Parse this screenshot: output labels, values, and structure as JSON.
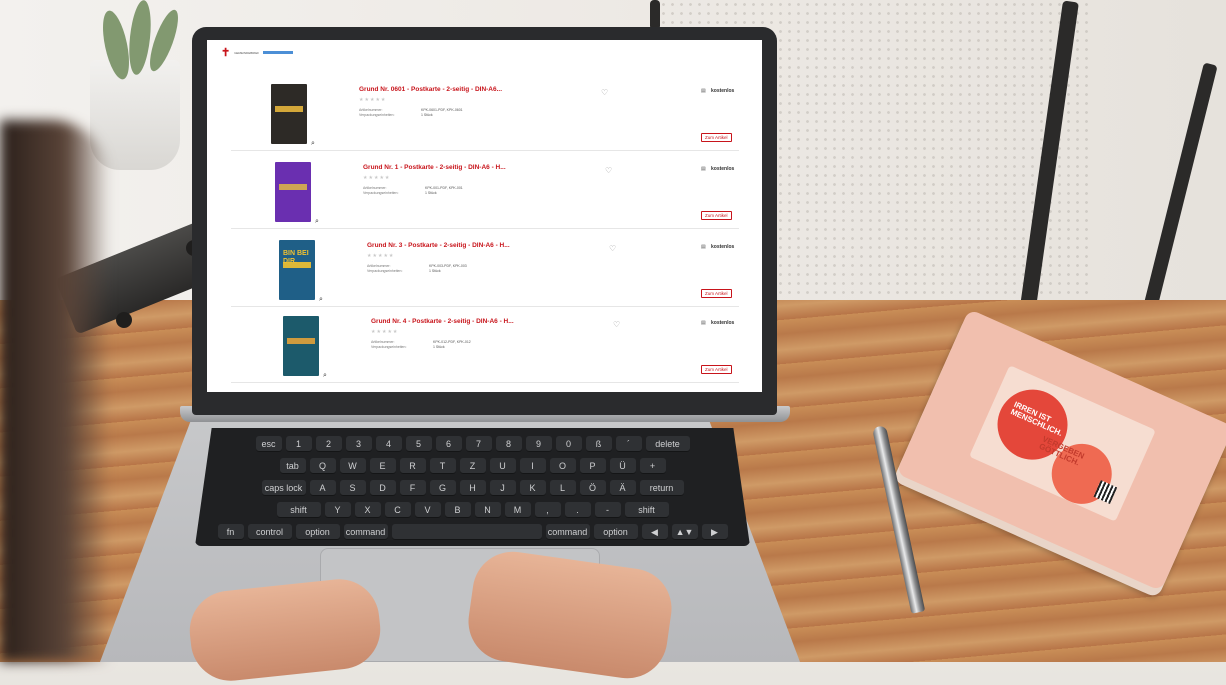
{
  "site": {
    "logo_cross": "✝",
    "logo_text": "GEMEINDEBRIEF"
  },
  "products": [
    {
      "title": "Grund Nr. 0601 - Postkarte - 2-seitig - DIN-A6...",
      "stars": "★★★★★",
      "meta_labels": "Artikelnummer:\nVerpackungseinheiten:",
      "meta_values": "KPK-0601-PDF, KPK-0601\n1 Stück",
      "price_label": "kostenlos",
      "cta": "Zum Artikel",
      "thumb_color": "#2d2a26",
      "accent": "#e6b53c"
    },
    {
      "title": "Grund Nr. 1 - Postkarte - 2-seitig - DIN-A6 - H...",
      "stars": "★★★★★",
      "meta_labels": "Artikelnummer:\nVerpackungseinheiten:",
      "meta_values": "KPK-001-PDF, KPK-001\n1 Stück",
      "price_label": "kostenlos",
      "cta": "Zum Artikel",
      "thumb_color": "#6a2fb0",
      "accent": "#d9b14a"
    },
    {
      "title": "Grund Nr. 3 - Postkarte - 2-seitig - DIN-A6 - H...",
      "stars": "★★★★★",
      "meta_labels": "Artikelnummer:\nVerpackungseinheiten:",
      "meta_values": "KPK-003-PDF, KPK-003\n1 Stück",
      "price_label": "kostenlos",
      "cta": "Zum Artikel",
      "thumb_color": "#1f5f87",
      "accent": "#f2c230",
      "thumb_text": "BIN BEI DIR."
    },
    {
      "title": "Grund Nr. 4 - Postkarte - 2-seitig - DIN-A6 - H...",
      "stars": "★★★★★",
      "meta_labels": "Artikelnummer:\nVerpackungseinheiten:",
      "meta_values": "KPK-012-PDF, KPK-012\n1 Stück",
      "price_label": "kostenlos",
      "cta": "Zum Artikel",
      "thumb_color": "#1c5a6b",
      "accent": "#e3a23a"
    }
  ],
  "keyboard": {
    "row1": [
      "esc",
      "1",
      "2",
      "3",
      "4",
      "5",
      "6",
      "7",
      "8",
      "9",
      "0",
      "ß",
      "´",
      "delete"
    ],
    "row2": [
      "tab",
      "Q",
      "W",
      "E",
      "R",
      "T",
      "Z",
      "U",
      "I",
      "O",
      "P",
      "Ü",
      "+"
    ],
    "row3": [
      "caps lock",
      "A",
      "S",
      "D",
      "F",
      "G",
      "H",
      "J",
      "K",
      "L",
      "Ö",
      "Ä",
      "return"
    ],
    "row4": [
      "shift",
      "Y",
      "X",
      "C",
      "V",
      "B",
      "N",
      "M",
      ",",
      ".",
      "-",
      "shift"
    ],
    "row5": [
      "fn",
      "control",
      "option",
      "command",
      "",
      "command",
      "option",
      "◀",
      "▲▼",
      "▶"
    ]
  },
  "notebook": {
    "line1": "IRREN IST",
    "line2": "MENSCHLICH.",
    "line3": "VERGEBEN",
    "line4": "GÖTTLICH."
  }
}
